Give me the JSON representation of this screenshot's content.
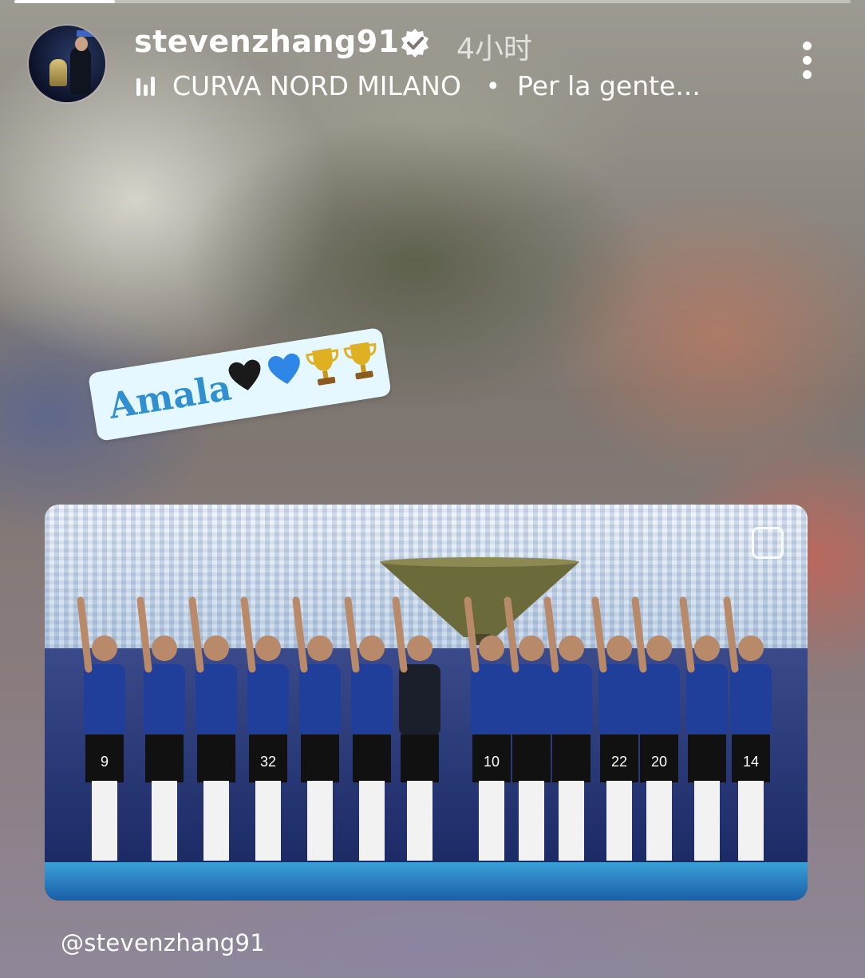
{
  "story": {
    "progress": 0.12,
    "username": "stevenzhang91",
    "time": "4小时",
    "music": {
      "artist": "CURVA NORD MILANO",
      "separator": "•",
      "title": "Per la gente..."
    }
  },
  "sticker": {
    "text": "Amala",
    "emojis": [
      "black-heart",
      "blue-heart",
      "trophy",
      "trophy"
    ]
  },
  "post": {
    "jersey_numbers": [
      "9",
      "32",
      "10",
      "22",
      "20",
      "14"
    ]
  },
  "mention": "@stevenzhang91",
  "colors": {
    "sticker_text": "#2f8fd0",
    "sticker_bg": "#e6f8ff",
    "kit_blue": "#1f3f9a"
  }
}
